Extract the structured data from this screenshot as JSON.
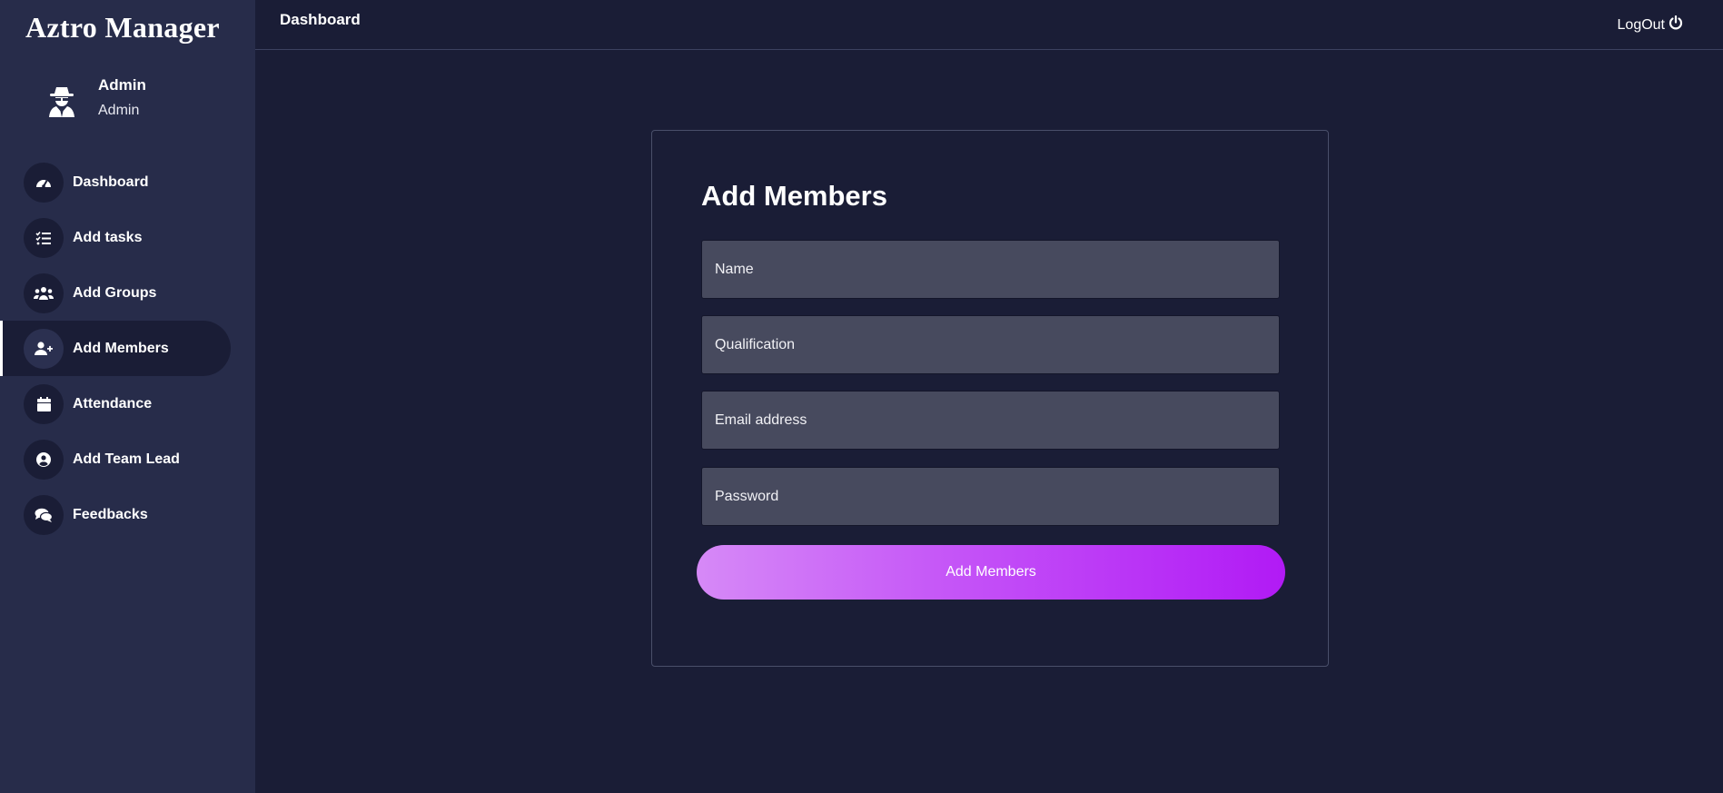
{
  "sidebar": {
    "brand": "Aztro Manager",
    "profile": {
      "name": "Admin",
      "role": "Admin",
      "avatar_icon": "user-secret-icon"
    },
    "items": [
      {
        "label": "Dashboard",
        "icon": "tachometer-icon",
        "active": false
      },
      {
        "label": "Add tasks",
        "icon": "task-list-icon",
        "active": false
      },
      {
        "label": "Add Groups",
        "icon": "users-group-icon",
        "active": false
      },
      {
        "label": "Add Members",
        "icon": "user-plus-icon",
        "active": true
      },
      {
        "label": "Attendance",
        "icon": "calendar-icon",
        "active": false
      },
      {
        "label": "Add Team Lead",
        "icon": "user-circle-icon",
        "active": false
      },
      {
        "label": "Feedbacks",
        "icon": "comments-icon",
        "active": false
      }
    ]
  },
  "header": {
    "title": "Dashboard",
    "logout_label": "LogOut",
    "logout_icon": "power-icon"
  },
  "form": {
    "title": "Add Members",
    "fields": {
      "name": {
        "placeholder": "Name",
        "value": ""
      },
      "qualification": {
        "placeholder": "Qualification",
        "value": ""
      },
      "email": {
        "placeholder": "Email address",
        "value": ""
      },
      "password": {
        "placeholder": "Password",
        "value": ""
      }
    },
    "submit_label": "Add Members"
  },
  "colors": {
    "background": "#1a1d36",
    "sidebar": "#272c4a",
    "input": "#474a5e",
    "button_gradient_start": "#d689f7",
    "button_gradient_end": "#b11af5"
  }
}
